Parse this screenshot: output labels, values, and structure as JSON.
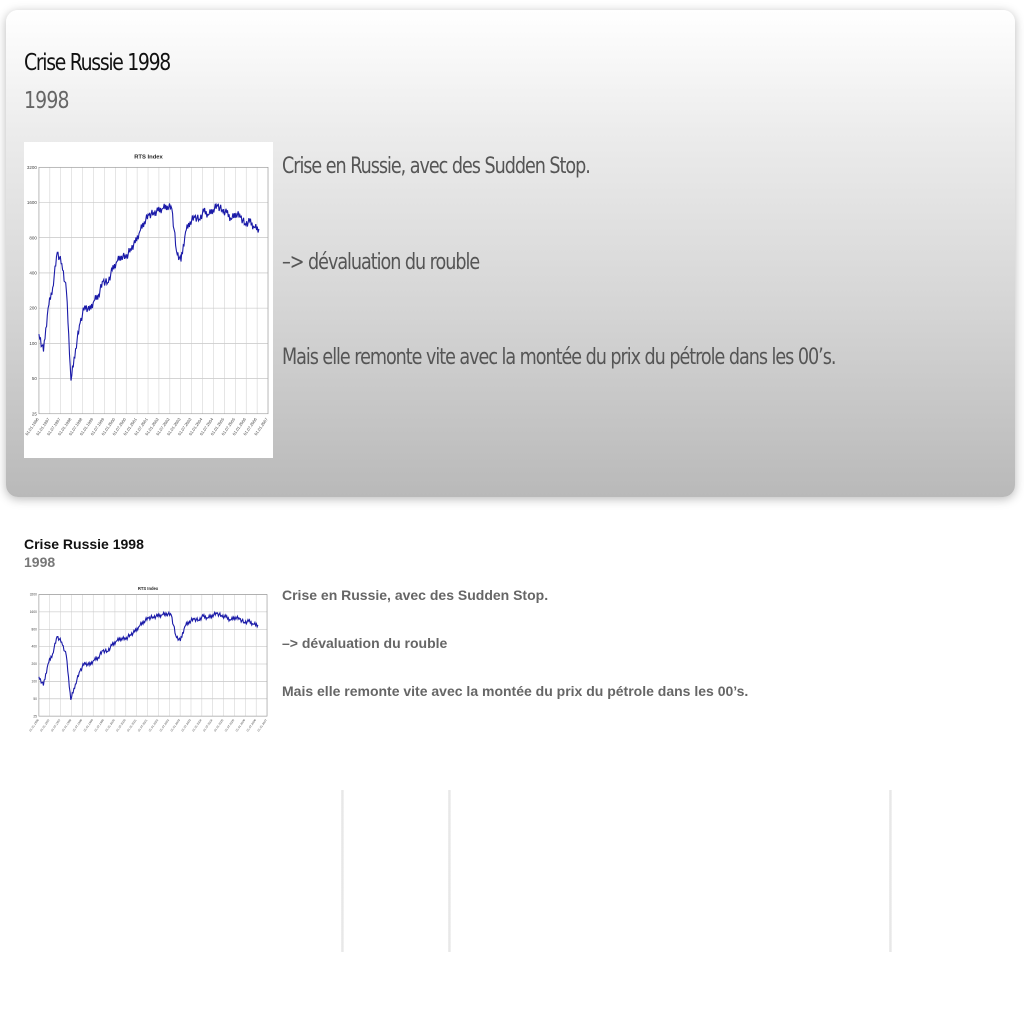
{
  "slide": {
    "title": "Crise Russie 1998",
    "subtitle": "1998",
    "lines": [
      "Crise en Russie, avec des Sudden Stop.",
      " –> dévaluation du rouble",
      "Mais elle remonte vite avec la montée du prix du pétrole dans les 00’s."
    ]
  },
  "preview": {
    "title": "Crise Russie 1998",
    "subtitle": "1998",
    "lines": [
      "Crise en Russie, avec des Sudden Stop.",
      " –> dévaluation du rouble",
      "Mais elle remonte vite avec la montée du prix du pétrole dans les 00’s."
    ]
  },
  "chart_data": {
    "type": "line",
    "title": "RTS Index",
    "line_color": "#1a1aa8",
    "yscale": "log",
    "yticks": [
      "25",
      "50",
      "100",
      "200",
      "400",
      "800",
      "1600",
      "3200"
    ],
    "xticks": [
      "01.01.1996",
      "01.01.1997",
      "01.07.1997",
      "01.01.1998",
      "01.07.1998",
      "01.01.1999",
      "01.07.1999",
      "01.01.2000",
      "01.07.2000",
      "01.01.2001",
      "01.07.2001",
      "01.01.2002",
      "01.07.2002",
      "01.01.2003",
      "01.07.2003",
      "01.01.2004",
      "01.07.2004",
      "01.01.2005",
      "01.07.2005",
      "01.01.2006",
      "01.07.2006",
      "01.01.2007"
    ],
    "series": [
      {
        "x": [
          0,
          0.02,
          0.04,
          0.06,
          0.08,
          0.1,
          0.12,
          0.14,
          0.16,
          0.18,
          0.2,
          0.22,
          0.24,
          0.26,
          0.28,
          0.3,
          0.32,
          0.34,
          0.36,
          0.38,
          0.4,
          0.42,
          0.44,
          0.46,
          0.48,
          0.5,
          0.52,
          0.54,
          0.56,
          0.58,
          0.6,
          0.62,
          0.64,
          0.66,
          0.68,
          0.7,
          0.72,
          0.74,
          0.76,
          0.78,
          0.8,
          0.82,
          0.84,
          0.86,
          0.88,
          0.9,
          0.92,
          0.94,
          0.96
        ],
        "y": [
          120,
          85,
          200,
          300,
          600,
          480,
          280,
          48,
          90,
          150,
          210,
          190,
          230,
          260,
          340,
          330,
          420,
          500,
          560,
          540,
          640,
          720,
          900,
          1100,
          1250,
          1300,
          1350,
          1420,
          1500,
          1420,
          620,
          500,
          900,
          1100,
          1200,
          1150,
          1350,
          1250,
          1400,
          1500,
          1380,
          1300,
          1150,
          1300,
          1200,
          1050,
          1100,
          980,
          950
        ]
      }
    ]
  }
}
